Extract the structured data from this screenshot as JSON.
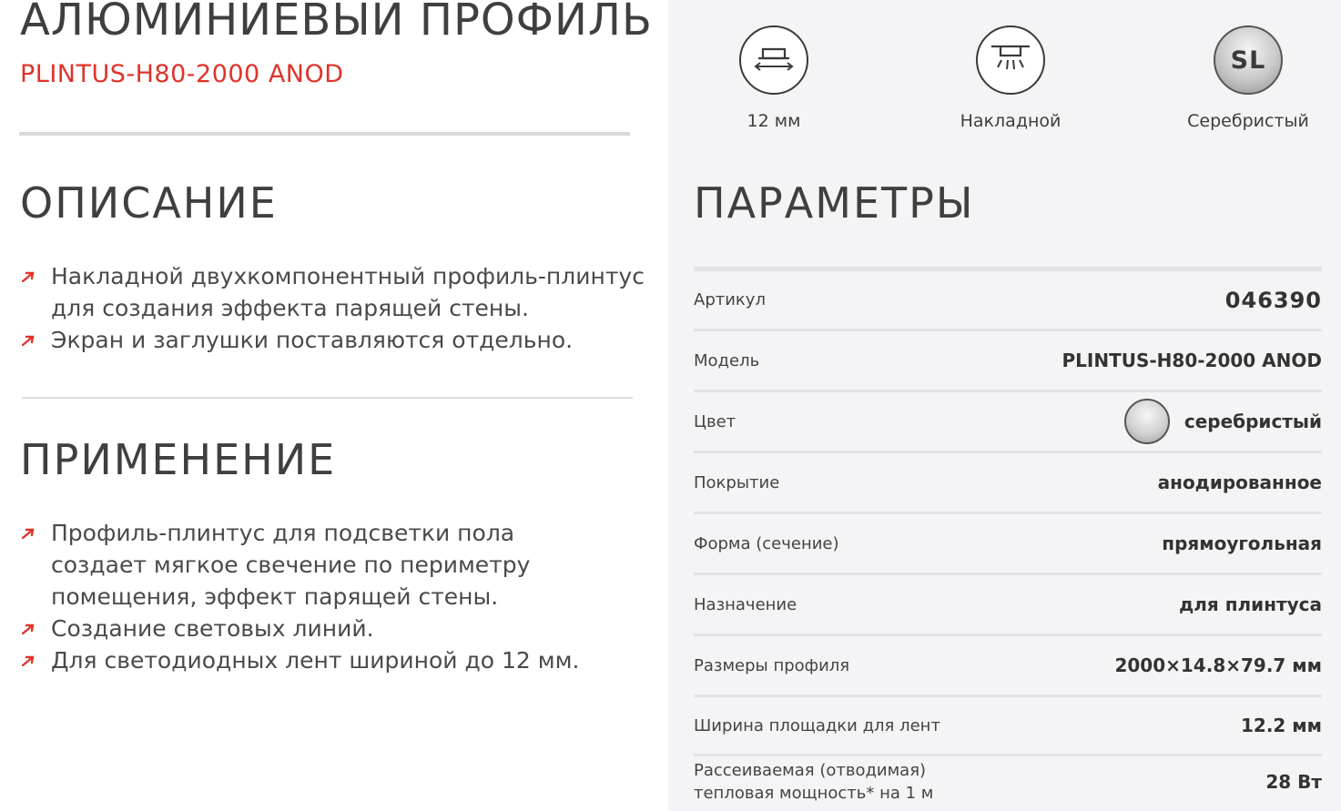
{
  "product": {
    "title": "АЛЮМИНИЕВЫЙ ПРОФИЛЬ",
    "model": "PLINTUS-H80-2000 ANOD"
  },
  "description": {
    "title": "ОПИСАНИЕ",
    "items": [
      "Накладной двухкомпонентный профиль-плинтус для создания эффекта парящей стены.",
      "Экран и заглушки поставляются отдельно."
    ]
  },
  "application": {
    "title": "ПРИМЕНЕНИЕ",
    "items": [
      "Профиль-плинтус для подсветки пола создает мягкое свечение по периметру помещения, эффект парящей стены.",
      "Создание световых линий.",
      "Для светодиодных лент шириной до 12 мм."
    ]
  },
  "features": [
    {
      "icon": "width-icon",
      "label": "12 мм"
    },
    {
      "icon": "surface-mount-icon",
      "label": "Накладной"
    },
    {
      "icon": "silver-color-icon",
      "badge": "SL",
      "label": "Серебристый"
    }
  ],
  "params": {
    "title": "ПАРАМЕТРЫ",
    "rows": [
      {
        "key": "Артикул",
        "value": "046390"
      },
      {
        "key": "Модель",
        "value": "PLINTUS-H80-2000 ANOD"
      },
      {
        "key": "Цвет",
        "value": "серебристый"
      },
      {
        "key": "Покрытие",
        "value": "анодированное"
      },
      {
        "key": "Форма (сечение)",
        "value": "прямоугольная"
      },
      {
        "key": "Назначение",
        "value": "для плинтуса"
      },
      {
        "key": "Размеры профиля",
        "value": "2000×14.8×79.7 мм"
      },
      {
        "key": "Ширина площадки для лент",
        "value": "12.2 мм"
      },
      {
        "key_line1": "Рассеиваемая (отводимая)",
        "key_line2": "тепловая мощность* на 1 м",
        "value": "28 Вт"
      }
    ]
  },
  "colors": {
    "accent": "#e0332b",
    "text": "#3f3f3f",
    "panel": "#f4f4f6"
  }
}
